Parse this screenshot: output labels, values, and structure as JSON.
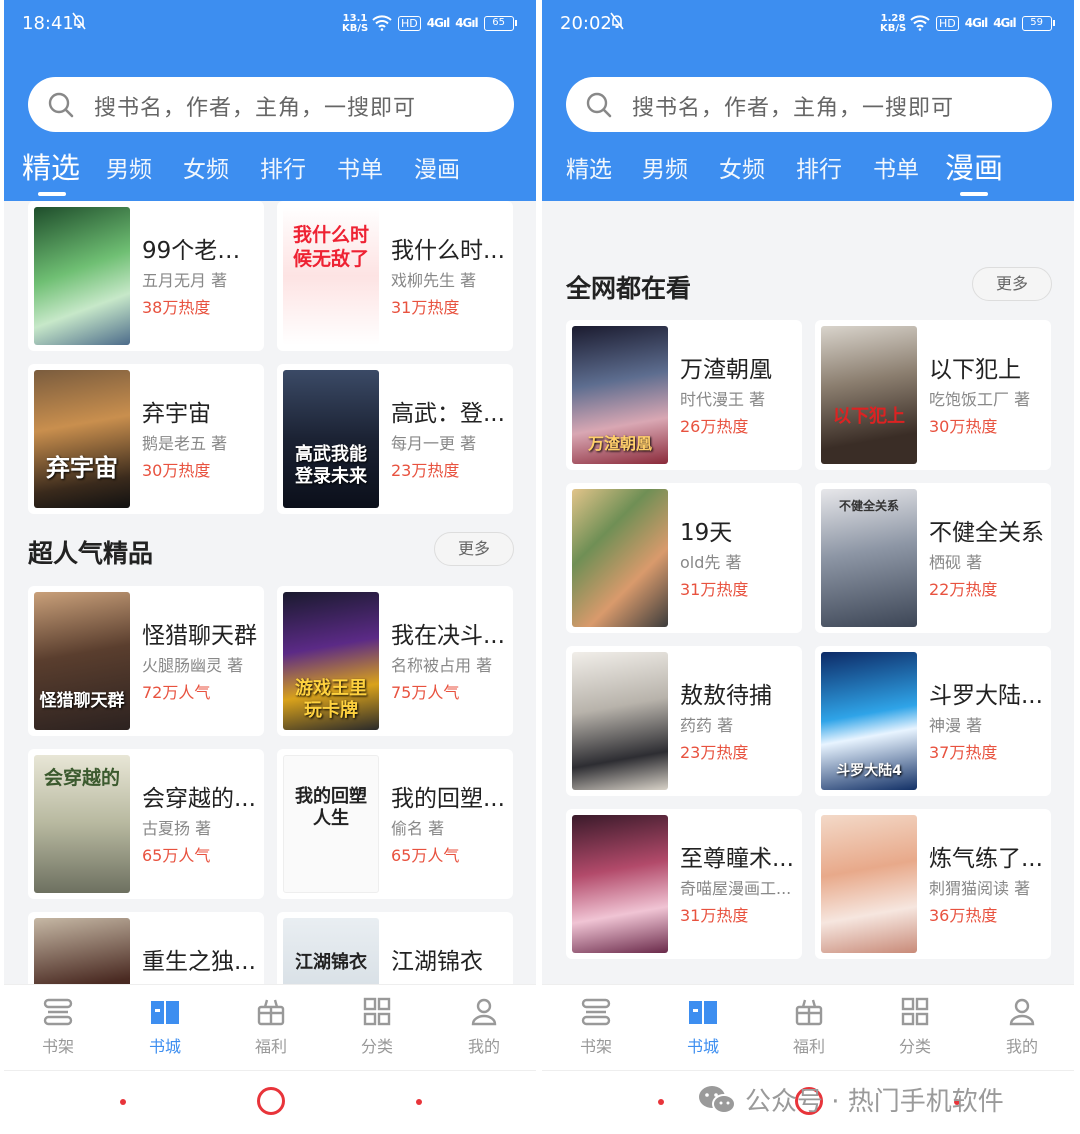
{
  "search_placeholder": "搜书名，作者，主角，一搜即可",
  "tabs": [
    "精选",
    "男频",
    "女频",
    "排行",
    "书单",
    "漫画"
  ],
  "nav": [
    "书架",
    "书城",
    "福利",
    "分类",
    "我的"
  ],
  "left": {
    "time": "18:41",
    "netspeed": [
      "13.1",
      "KB/S"
    ],
    "hd": "HD",
    "signal1": "4G",
    "signal2": "4G",
    "battery": "65",
    "top_books": [
      {
        "title": "99个老婆...",
        "author": "五月无月 著",
        "heat": "38万热度",
        "cover_text": ""
      },
      {
        "title": "我什么时...",
        "author": "戏柳先生 著",
        "heat": "31万热度",
        "cover_text": "我什么时候无敌了"
      },
      {
        "title": "弃宇宙",
        "author": "鹅是老五 著",
        "heat": "30万热度",
        "cover_text": "弃宇宙"
      },
      {
        "title": "高武：登...",
        "author": "每月一更 著",
        "heat": "23万热度",
        "cover_text": "高武我能登录未来"
      }
    ],
    "section_title": "超人气精品",
    "more": "更多",
    "popular_books": [
      {
        "title": "怪猎聊天群",
        "author": "火腿肠幽灵 著",
        "heat": "72万人气",
        "cover_text": "怪猎聊天群"
      },
      {
        "title": "我在决斗...",
        "author": "名称被占用 著",
        "heat": "75万人气",
        "cover_text": "游戏王里玩卡牌"
      },
      {
        "title": "会穿越的...",
        "author": "古夏扬 著",
        "heat": "65万人气",
        "cover_text": "会穿越的"
      },
      {
        "title": "我的回塑...",
        "author": "偷名 著",
        "heat": "65万人气",
        "cover_text": "我的回塑人生"
      },
      {
        "title": "重生之独...",
        "author": "",
        "heat": "",
        "cover_text": ""
      },
      {
        "title": "江湖锦衣",
        "author": "",
        "heat": "",
        "cover_text": "江湖锦衣"
      }
    ]
  },
  "right": {
    "time": "20:02",
    "netspeed": [
      "1.28",
      "KB/S"
    ],
    "hd": "HD",
    "signal1": "4G",
    "signal2": "4G",
    "battery": "59",
    "section_title": "全网都在看",
    "more": "更多",
    "comics": [
      {
        "title": "万渣朝凰",
        "author": "时代漫王 著",
        "heat": "26万热度",
        "cover_text": "万渣朝凰"
      },
      {
        "title": "以下犯上",
        "author": "吃饱饭工厂 著",
        "heat": "30万热度",
        "cover_text": "以下犯上"
      },
      {
        "title": "19天",
        "author": "old先 著",
        "heat": "31万热度",
        "cover_text": ""
      },
      {
        "title": "不健全关系",
        "author": "栖砚 著",
        "heat": "22万热度",
        "cover_text": "不健全关系"
      },
      {
        "title": "敖敖待捕",
        "author": "药药 著",
        "heat": "23万热度",
        "cover_text": ""
      },
      {
        "title": "斗罗大陆...",
        "author": "神漫 著",
        "heat": "37万热度",
        "cover_text": "斗罗大陆4"
      },
      {
        "title": "至尊瞳术...",
        "author": "奇喵屋漫画工...",
        "heat": "31万热度",
        "cover_text": ""
      },
      {
        "title": "炼气练了...",
        "author": "刺猬猫阅读 著",
        "heat": "36万热度",
        "cover_text": ""
      }
    ]
  },
  "watermark": "公众号 · 热门手机软件",
  "colors": {
    "header_blue": "#3d8ef0",
    "heat_red": "#e8523f",
    "sys_red": "#e8343a"
  },
  "icons": [
    "search-icon",
    "bookshelf-icon",
    "bookstore-icon",
    "gift-icon",
    "grid-icon",
    "user-icon",
    "wechat-icon",
    "silent-bell-icon"
  ]
}
